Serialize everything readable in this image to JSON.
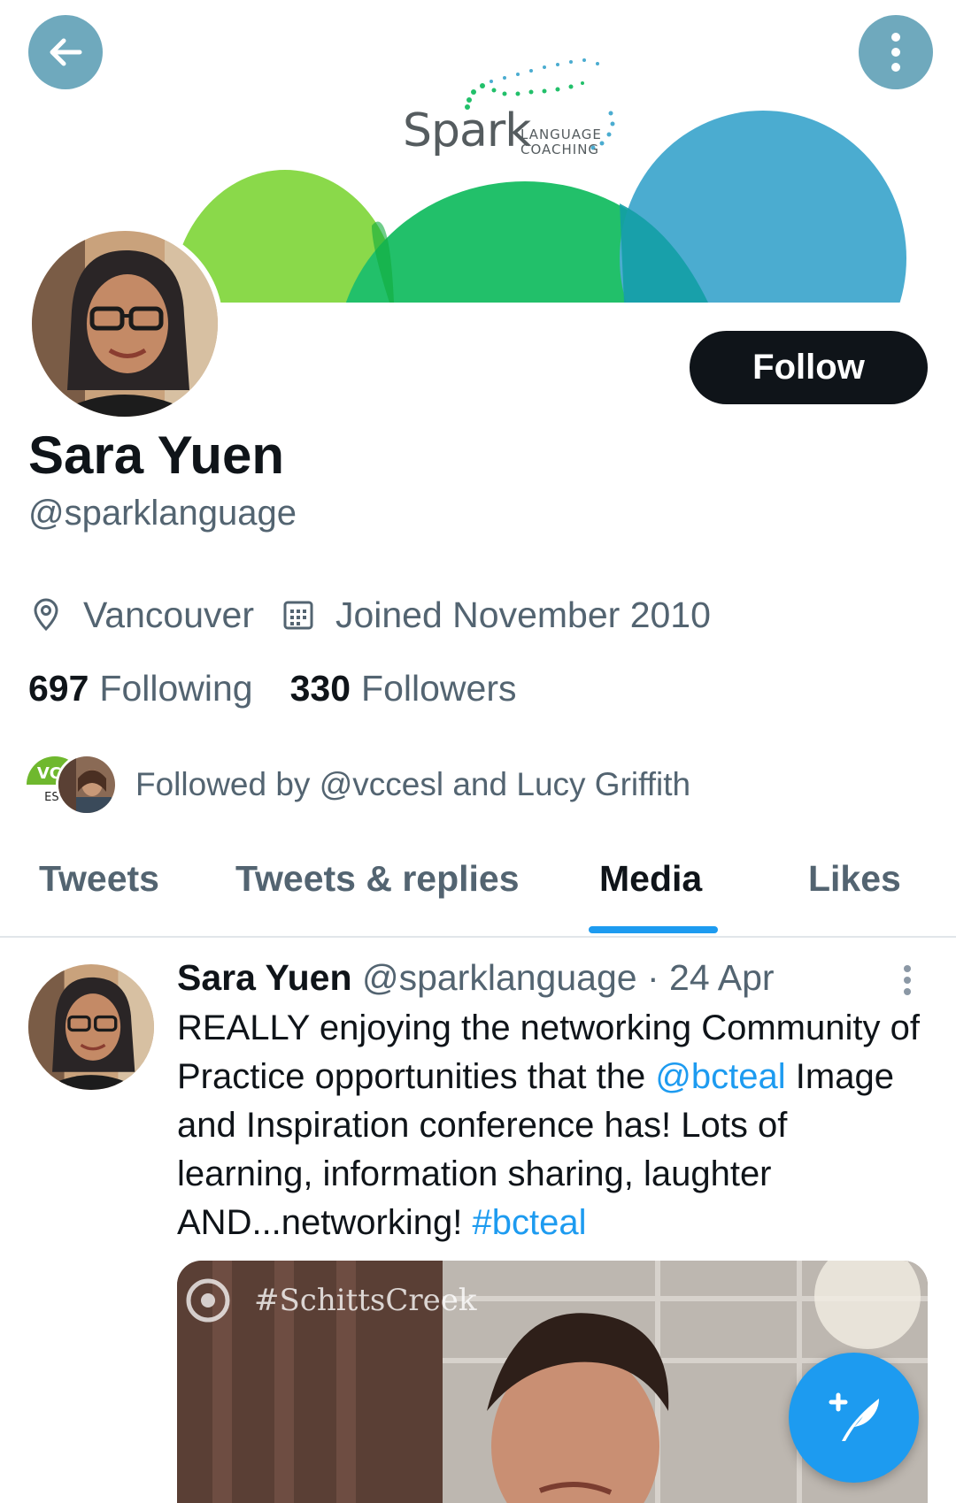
{
  "banner": {
    "logo_word": "Spark",
    "logo_sub_line1": "LANGUAGE",
    "logo_sub_line2": "COACHING",
    "colors": {
      "lime": "#8ad94a",
      "green": "#22c06a",
      "blue": "#4bacd0"
    }
  },
  "header": {
    "back_icon": "arrow-left-icon",
    "more_icon": "more-vertical-icon"
  },
  "profile": {
    "name": "Sara Yuen",
    "handle": "@sparklanguage",
    "follow_label": "Follow",
    "location": "Vancouver",
    "joined": "Joined November 2010",
    "following_count": "697",
    "following_label": "Following",
    "followers_count": "330",
    "followers_label": "Followers",
    "followed_by": "Followed by @vccesl and Lucy Griffith",
    "followed_by_badge_top": "VCC",
    "followed_by_badge_bottom": "ESL"
  },
  "tabs": [
    {
      "label": "Tweets",
      "active": false
    },
    {
      "label": "Tweets & replies",
      "active": false
    },
    {
      "label": "Media",
      "active": true
    },
    {
      "label": "Likes",
      "active": false
    }
  ],
  "tweet": {
    "name": "Sara Yuen",
    "handle": "@sparklanguage",
    "date": "· 24 Apr",
    "text_part1": "REALLY enjoying the networking Community of Practice opportunities that the ",
    "mention": "@bcteal",
    "text_part2": " Image and Inspiration conference has! Lots of learning, information sharing, laughter AND...networking! ",
    "hashtag": "#bcteal",
    "media_tag": "#SchittsCreek"
  },
  "fab": {
    "icon": "compose-tweet-icon"
  },
  "colors": {
    "accent": "#1d9bf0",
    "text": "#0f1419",
    "muted": "#536471"
  }
}
